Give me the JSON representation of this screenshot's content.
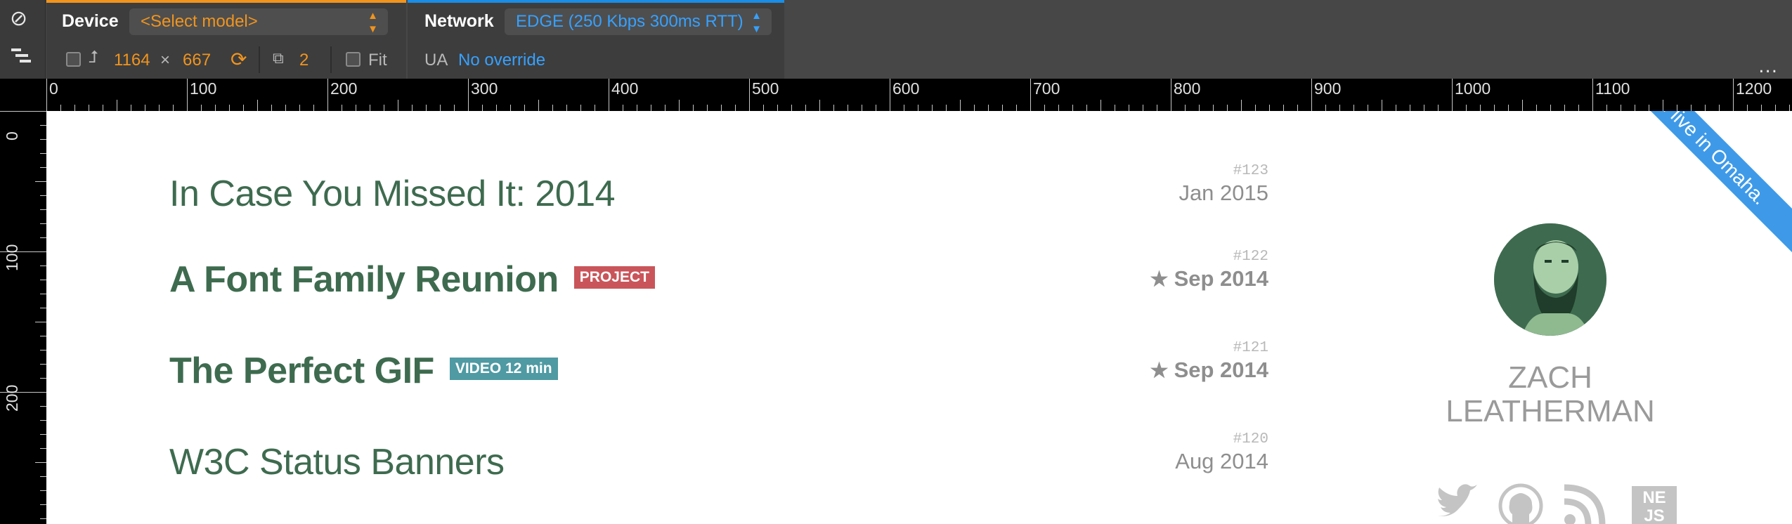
{
  "toolbar": {
    "device_label": "Device",
    "model_select": "<Select model>",
    "width": "1164",
    "times": "×",
    "height": "667",
    "dpr": "2",
    "fit_label": "Fit",
    "network_label": "Network",
    "throttle_select": "EDGE (250 Kbps 300ms RTT)",
    "ua_label": "UA",
    "ua_value": "No override",
    "more": "..."
  },
  "ruler": {
    "horizontal": [
      "0",
      "100",
      "200",
      "300",
      "400",
      "500",
      "600",
      "700",
      "800",
      "900",
      "1000",
      "1100",
      "1200"
    ],
    "vertical": [
      "0",
      "100",
      "200"
    ]
  },
  "posts": [
    {
      "title": "In Case You Missed It: 2014",
      "number": "#123",
      "date": "Jan 2015",
      "featured": false,
      "badge": ""
    },
    {
      "title": "A Font Family Reunion",
      "number": "#122",
      "date": "Sep 2014",
      "featured": true,
      "badge": "PROJECT"
    },
    {
      "title": "The Perfect GIF",
      "number": "#121",
      "date": "Sep 2014",
      "featured": true,
      "badge": "VIDEO 12 min"
    },
    {
      "title": "W3C Status Banners",
      "number": "#120",
      "date": "Aug 2014",
      "featured": false,
      "badge": ""
    }
  ],
  "sidebar": {
    "name_line1": "ZACH",
    "name_line2": "LEATHERMAN",
    "ribbon": "I live in Omaha.",
    "social_icons": [
      "twitter-icon",
      "github-icon",
      "rss-icon",
      "nejs-icon"
    ],
    "nejs_text": "NE JS"
  },
  "colors": {
    "title_green": "#3e6b4f",
    "project_badge": "#c9555a",
    "video_badge": "#4f9aa3",
    "ribbon_blue": "#3e9ae8",
    "device_accent": "#f0941e",
    "network_accent": "#1a8de6"
  }
}
